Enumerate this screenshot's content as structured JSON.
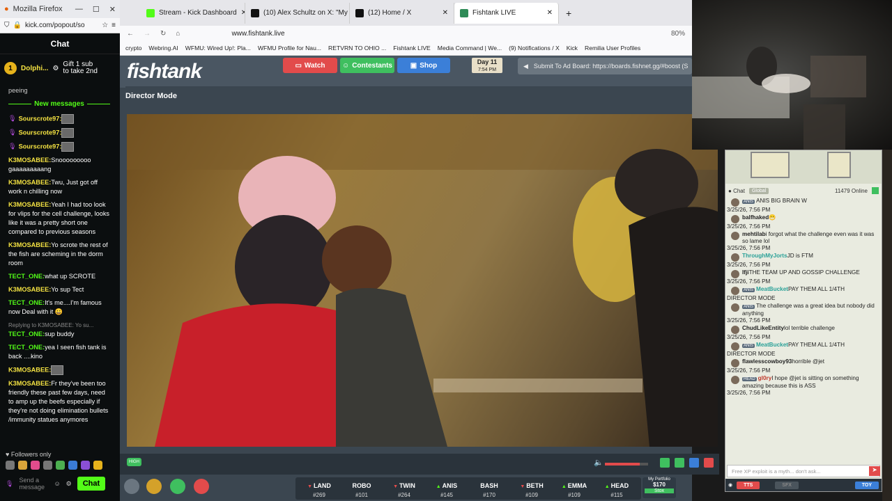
{
  "kick": {
    "window_title": "Mozilla Firefox",
    "url": "kick.com/popout/so",
    "header": "Chat",
    "pinned_user": "Dolphi...",
    "pinned_count": "1",
    "pinned_gift": "Gift 1 sub to take 2nd",
    "peek": "peeing",
    "new_messages": "New messages",
    "messages": [
      {
        "user": "Sourscrote97:",
        "text": "",
        "color": "#f5e342",
        "mic": true,
        "thumb": true
      },
      {
        "user": "Sourscrote97:",
        "text": "",
        "color": "#f5e342",
        "mic": true,
        "thumb": true
      },
      {
        "user": "Sourscrote97:",
        "text": "",
        "color": "#f5e342",
        "mic": true,
        "thumb": true
      },
      {
        "user": "K3MOSABEE:",
        "text": "Snooooooooo gaaaaaaaaang",
        "color": "#f5e342"
      },
      {
        "user": "K3MOSABEE:",
        "text": "Twu, Just got off work n chilling now",
        "color": "#f5e342"
      },
      {
        "user": "K3MOSABEE:",
        "text": "Yeah I had too look for vlips for the cell challenge, looks like it was a pretty short one compared to previous seasons",
        "color": "#f5e342"
      },
      {
        "user": "K3MOSABEE:",
        "text": "Yo scrote the rest of the fish are scheming in the dorm room",
        "color": "#f5e342"
      },
      {
        "user": "TECT_ONE:",
        "text": "what up SCROTE",
        "color": "#53fc18"
      },
      {
        "user": "K3MOSABEE:",
        "text": "Yo sup Tect",
        "color": "#f5e342"
      },
      {
        "user": "TECT_ONE:",
        "text": "It's me....I'm famous now Deal with it 😀",
        "color": "#53fc18"
      },
      {
        "user": "TECT_ONE:",
        "text": "sup buddy",
        "color": "#53fc18",
        "reply": "Replying to K3MOSABEE: Yo su..."
      },
      {
        "user": "TECT_ONE:",
        "text": "yea I seen fish tank is back ....kino",
        "color": "#53fc18"
      },
      {
        "user": "K3MOSABEE:",
        "text": "",
        "color": "#f5e342",
        "thumb": true
      },
      {
        "user": "K3MOSABEE:",
        "text": "Fr they've been too friendly these past few days, need to amp up the beefs especially if they're not doing elimination bullets /immunity statues anymores",
        "color": "#f5e342"
      }
    ],
    "followers_only": "Followers only",
    "input_placeholder": "Send a message",
    "chat_button": "Chat",
    "emote_colors": [
      "#777",
      "#d9a43a",
      "#e04c8c",
      "#777",
      "#4caf50",
      "#3a7bd5",
      "#8a4fd6",
      "#e6b21b"
    ]
  },
  "browser": {
    "tabs": [
      {
        "label": "Stream - Kick Dashboard",
        "color": "#53fc18",
        "active": false
      },
      {
        "label": "(10) Alex Schultz on X: \"My New",
        "color": "#111",
        "active": false
      },
      {
        "label": "(12) Home / X",
        "color": "#111",
        "active": false
      },
      {
        "label": "Fishtank LIVE",
        "color": "#2e8b57",
        "active": true
      }
    ],
    "url": "www.fishtank.live",
    "zoom": "80%",
    "bookmarks": [
      "crypto",
      "Webring.AI",
      "WFMU: Wired Up!: Pla...",
      "WFMU Profile for Nau...",
      "RETVRN TO OHIO ...",
      "Fishtank LIVE",
      "Media Command | We...",
      "(9) Notifications / X",
      "Kick",
      "Remilia User Profiles"
    ]
  },
  "fishtank": {
    "logo": "fishtank",
    "watch": "Watch",
    "contestants": "Contestants",
    "shop": "Shop",
    "day": "Day 11",
    "time": "7:54 PM",
    "adboard": "Submit To Ad Board: https://boards.fishnet.gg/#boost (S",
    "director": "Director Mode",
    "quality": "HIGH",
    "volume": 0.8,
    "portfolio_label": "My Portfolio",
    "portfolio_value": "$170",
    "stox": "Stox",
    "contestants_list": [
      {
        "name": "LAND",
        "num": "#269",
        "trend": "down",
        "color": "#e74c4c"
      },
      {
        "name": "ROBO",
        "num": "#101",
        "trend": "flat",
        "color": "#ffffff"
      },
      {
        "name": "TWIN",
        "num": "#264",
        "trend": "down",
        "color": "#e74c4c"
      },
      {
        "name": "ANIS",
        "num": "#145",
        "trend": "up",
        "color": "#53fc18"
      },
      {
        "name": "BASH",
        "num": "#170",
        "trend": "flat",
        "color": "#ffffff"
      },
      {
        "name": "BETH",
        "num": "#109",
        "trend": "down",
        "color": "#e74c4c"
      },
      {
        "name": "EMMA",
        "num": "#109",
        "trend": "up",
        "color": "#53fc18"
      },
      {
        "name": "HEAD",
        "num": "#115",
        "trend": "up",
        "color": "#53fc18"
      }
    ]
  },
  "rchat": {
    "chat_label": "Chat",
    "global": "Global",
    "online": "11479 Online",
    "messages": [
      {
        "user": "",
        "badge": "ANIS",
        "text": "ANIS BIG BRAIN W",
        "ts": "3/25/26, 7:56 PM",
        "color": "#333"
      },
      {
        "user": "balfhaked",
        "badge": "",
        "text": "😬",
        "ts": "3/25/26, 7:56 PM",
        "color": "#222"
      },
      {
        "user": "mehtilab",
        "badge": "",
        "text": "i forgot what the challenge even was it was so lame lol",
        "ts": "3/25/26, 7:56 PM",
        "color": "#222"
      },
      {
        "user": "ThroughMyJorts",
        "badge": "",
        "text": "JD is FTM",
        "ts": "3/25/26, 7:56 PM",
        "color": "#2aa198"
      },
      {
        "user": "Ifji",
        "badge": "",
        "text": "THE TEAM UP AND GOSSIP CHALLENGE",
        "ts": "3/25/26, 7:56 PM",
        "color": "#222"
      },
      {
        "user": "MeatBucket",
        "badge": "ANIS",
        "text": "PAY THEM ALL 1/4TH",
        "ts": "DIRECTOR MODE",
        "color": "#2aa198"
      },
      {
        "user": "",
        "badge": "ANIS",
        "text": "The challenge was a great idea but nobody did anything",
        "ts": "3/25/26, 7:56 PM",
        "color": "#2aa198"
      },
      {
        "user": "ChudLikeEntity",
        "badge": "",
        "text": "lol terrible challenge",
        "ts": "3/25/26, 7:56 PM",
        "color": "#222"
      },
      {
        "user": "MeatBucket",
        "badge": "ANIS",
        "text": "PAY THEM ALL 1/4TH",
        "ts": "DIRECTOR MODE",
        "color": "#2aa198"
      },
      {
        "user": "flawlesscowboy93",
        "badge": "",
        "text": "horrible @jet",
        "ts": "3/25/26, 7:56 PM",
        "color": "#222"
      },
      {
        "user": "gl0ry",
        "badge": "HEAD",
        "text": "I hope @jet is sitting on something amazing because this is ASS",
        "ts": "3/25/26, 7:56 PM",
        "color": "#c0392b"
      }
    ],
    "input_placeholder": "Free XP exploit is a myth... don't ask...",
    "tts": "TTS",
    "sfx": "SFX",
    "toy": "TOY"
  }
}
